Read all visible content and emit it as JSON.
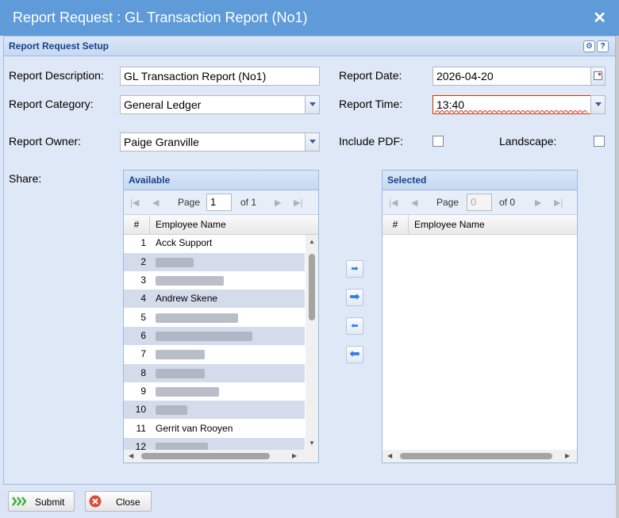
{
  "window": {
    "title": "Report Request : GL Transaction Report (No1)",
    "close_glyph": "✕"
  },
  "panel": {
    "title": "Report Request Setup",
    "tool_gear": "⚙",
    "tool_help": "?"
  },
  "form": {
    "description_label": "Report Description:",
    "description_value": "GL Transaction Report (No1)",
    "category_label": "Report Category:",
    "category_value": "General Ledger",
    "owner_label": "Report Owner:",
    "owner_value": "Paige Granville",
    "date_label": "Report Date:",
    "date_value": "2026-04-20",
    "time_label": "Report Time:",
    "time_value": "13:40",
    "pdf_label": "Include PDF:",
    "landscape_label": "Landscape:",
    "share_label": "Share:"
  },
  "available": {
    "title": "Available",
    "page_label": "Page",
    "page_value": "1",
    "of_label": "of 1",
    "col_num": "#",
    "col_name": "Employee Name",
    "rows": [
      {
        "num": "1",
        "name": "Acck Support"
      },
      {
        "num": "2",
        "name": ""
      },
      {
        "num": "3",
        "name": ""
      },
      {
        "num": "4",
        "name": "Andrew Skene"
      },
      {
        "num": "5",
        "name": ""
      },
      {
        "num": "6",
        "name": ""
      },
      {
        "num": "7",
        "name": ""
      },
      {
        "num": "8",
        "name": ""
      },
      {
        "num": "9",
        "name": ""
      },
      {
        "num": "10",
        "name": ""
      },
      {
        "num": "11",
        "name": "Gerrit van Rooyen"
      },
      {
        "num": "12",
        "name": ""
      }
    ]
  },
  "selected": {
    "title": "Selected",
    "page_label": "Page",
    "page_value": "0",
    "of_label": "of 0",
    "col_num": "#",
    "col_name": "Employee Name"
  },
  "footer": {
    "submit_label": "Submit",
    "close_label": "Close"
  }
}
